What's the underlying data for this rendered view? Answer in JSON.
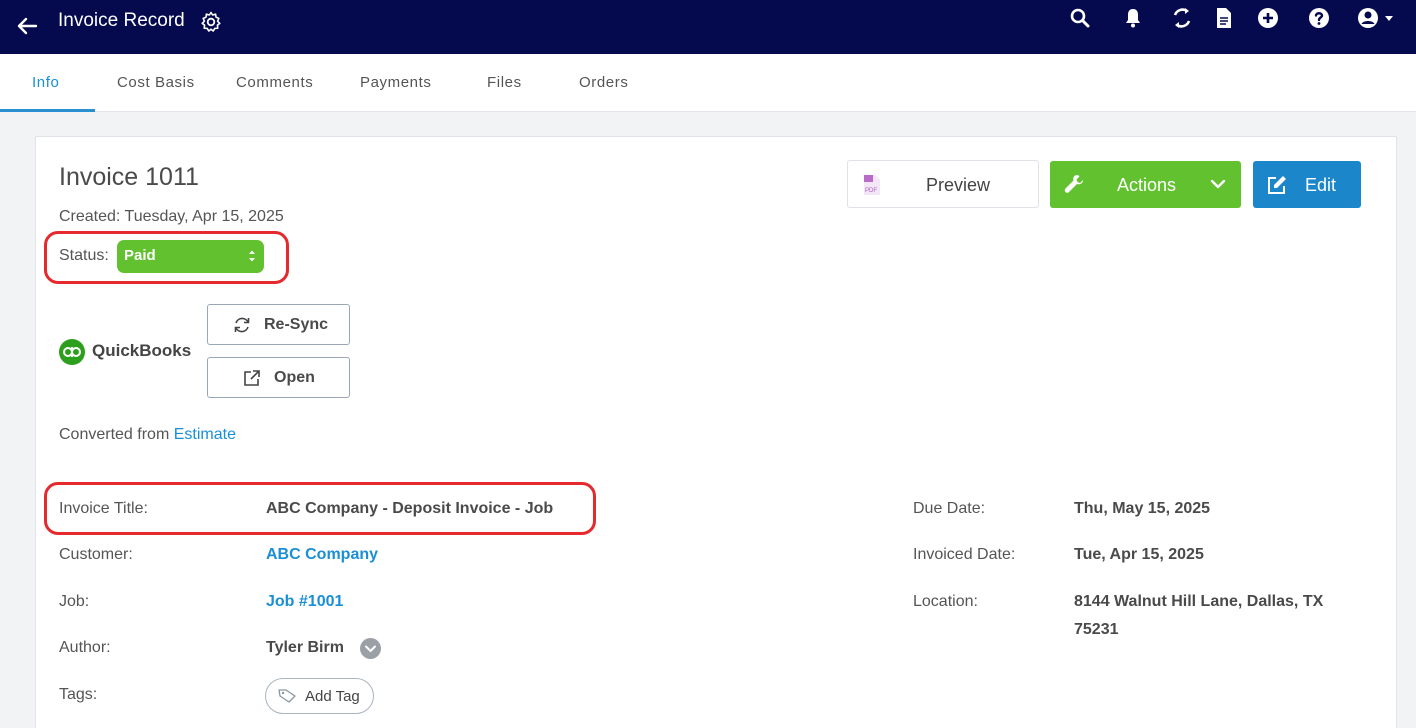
{
  "header": {
    "title": "Invoice Record",
    "icons": [
      "back-arrow-icon",
      "gear-icon",
      "search-icon",
      "bell-icon",
      "sync-icon",
      "document-icon",
      "plus-circle-icon",
      "help-icon",
      "user-menu-icon"
    ],
    "bg_color": "#050a4e"
  },
  "tabs": [
    {
      "label": "Info",
      "active": true
    },
    {
      "label": "Cost Basis",
      "active": false
    },
    {
      "label": "Comments",
      "active": false
    },
    {
      "label": "Payments",
      "active": false
    },
    {
      "label": "Files",
      "active": false
    },
    {
      "label": "Orders",
      "active": false
    }
  ],
  "invoice": {
    "title": "Invoice 1011",
    "created": "Created: Tuesday, Apr 15, 2025",
    "status_label": "Status:",
    "status_value": "Paid",
    "status_color": "#62c12f"
  },
  "quickbooks": {
    "label": "QuickBooks",
    "resync_label": "Re-Sync",
    "open_label": "Open"
  },
  "converted": {
    "prefix": "Converted from ",
    "link": "Estimate"
  },
  "buttons": {
    "preview": "Preview",
    "actions": "Actions",
    "edit": "Edit",
    "actions_color": "#62c12f",
    "edit_color": "#1b86c9"
  },
  "fields_left": [
    {
      "label": "Invoice Title:",
      "value": "ABC Company - Deposit Invoice - Job",
      "link": false
    },
    {
      "label": "Customer:",
      "value": "ABC Company",
      "link": true
    },
    {
      "label": "Job:",
      "value": "Job #1001",
      "link": true
    },
    {
      "label": "Author:",
      "value": "Tyler Birm",
      "link": false
    },
    {
      "label": "Tags:",
      "value": "Add Tag",
      "link": false
    }
  ],
  "fields_right": [
    {
      "label": "Due Date:",
      "value": "Thu, May 15, 2025"
    },
    {
      "label": "Invoiced Date:",
      "value": "Tue, Apr 15, 2025"
    },
    {
      "label": "Location:",
      "value": "8144 Walnut Hill Lane, Dallas, TX 75231"
    }
  ],
  "highlight_color": "#e5292c"
}
